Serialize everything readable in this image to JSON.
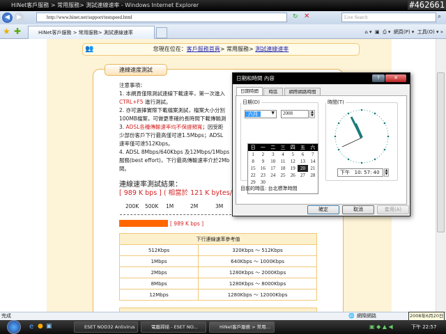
{
  "window": {
    "title": "HiNet客戶服務 > 常用服務> 測試連線速率 - Windows Internet Explorer",
    "corner_id": "#462661"
  },
  "toolbar": {
    "url": "http://www.hinet.net/support/testspeed.html",
    "search_placeholder": "Live Search",
    "tab_title": "HiNet客戶服務 > 常用服務> 測試連線速率",
    "page_menu": "網頁(P)",
    "tools_menu": "工具(O)"
  },
  "page": {
    "breadcrumb": {
      "prefix": "您現在位在：",
      "home": "客戶服務首頁",
      "sep1": "> 常用服務> ",
      "current": "測試連線速率"
    },
    "section_title": "連線速度測試",
    "notes": {
      "heading": "注意事項：",
      "l1": "1. 本網頁僅限測試連線下載速率，第一次進入",
      "l2a": "CTRL+F5",
      "l2b": " 進行測試。",
      "l3": "2. 亦可選擇實際下載檔案測試，檔案大小分別",
      "l4": "100MB檔案，可做更準確的長時間下載傳輸測",
      "l5a": "3. ",
      "l5b": "ADSL各種傳輸速率均不保證頻寬",
      "l5c": "；因受距",
      "l6": "少部份客戶下行最高僅可達1.5Mbps；ADSL",
      "l7": "速率僅可達512Kbps。",
      "l8": "4. ADSL 8Mbps/640Kbps 及12Mbps/1Mbps",
      "l9": "服務(best effort)，下行最高傳輸速率介於2Mb",
      "l10": "間。"
    },
    "result_heading": "連線速率測試結果：",
    "result_value": "[ 989 K bps ]  ( 相當於 121 K bytes/s",
    "scale": [
      "200K",
      "500K",
      "1M",
      "2M",
      "3M"
    ],
    "bar_value_kbps": 989,
    "bar_label": "[ 989 K bps ]",
    "table": {
      "header": "下行連線速率參考值",
      "rows": [
        [
          "512Kbps",
          "320Kbps  ～  512Kbps"
        ],
        [
          "1Mbps",
          "640Kbps  ～  1000Kbps"
        ],
        [
          "2Mbps",
          "1280Kbps  ～  2000Kbps"
        ],
        [
          "8Mbps",
          "1280Kbps  ～  8000Kbps"
        ],
        [
          "12Mbps",
          "1280Kbps  ～  12000Kbps"
        ]
      ]
    }
  },
  "dialog": {
    "title": "日期和時間 內容",
    "tabs": [
      "日期時間",
      "時區",
      "網際網路時間"
    ],
    "date_label": "日期(D)",
    "month": "六月",
    "year": "2008",
    "time_label": "時間(T)",
    "weekdays": [
      "日",
      "一",
      "二",
      "三",
      "四",
      "五",
      "六"
    ],
    "days": [
      [
        "1",
        "2",
        "3",
        "4",
        "5",
        "6",
        "7"
      ],
      [
        "8",
        "9",
        "10",
        "11",
        "12",
        "13",
        "14"
      ],
      [
        "15",
        "16",
        "17",
        "18",
        "19",
        "20",
        "21"
      ],
      [
        "22",
        "23",
        "24",
        "25",
        "26",
        "27",
        "28"
      ],
      [
        "29",
        "30",
        "",
        "",
        "",
        "",
        ""
      ]
    ],
    "selected_day": "20",
    "time_value": "下午   10: 57: 40",
    "timezone": "目前的時區: 台北標準時間",
    "ok": "確定",
    "cancel": "取消",
    "apply": "套用(A)"
  },
  "status": {
    "text": "完成",
    "zone": "網際網路",
    "date_tooltip": "2008年6月20日"
  },
  "taskbar": {
    "items": [
      "ESET NOD32 Antivirus",
      "電腦掃描 - ESET NO...",
      "HiNet客戶服務 > 常用..."
    ],
    "clock": "下午 22:57"
  },
  "colors": {
    "bar": "#ff6600",
    "red_text": "#d42020"
  }
}
